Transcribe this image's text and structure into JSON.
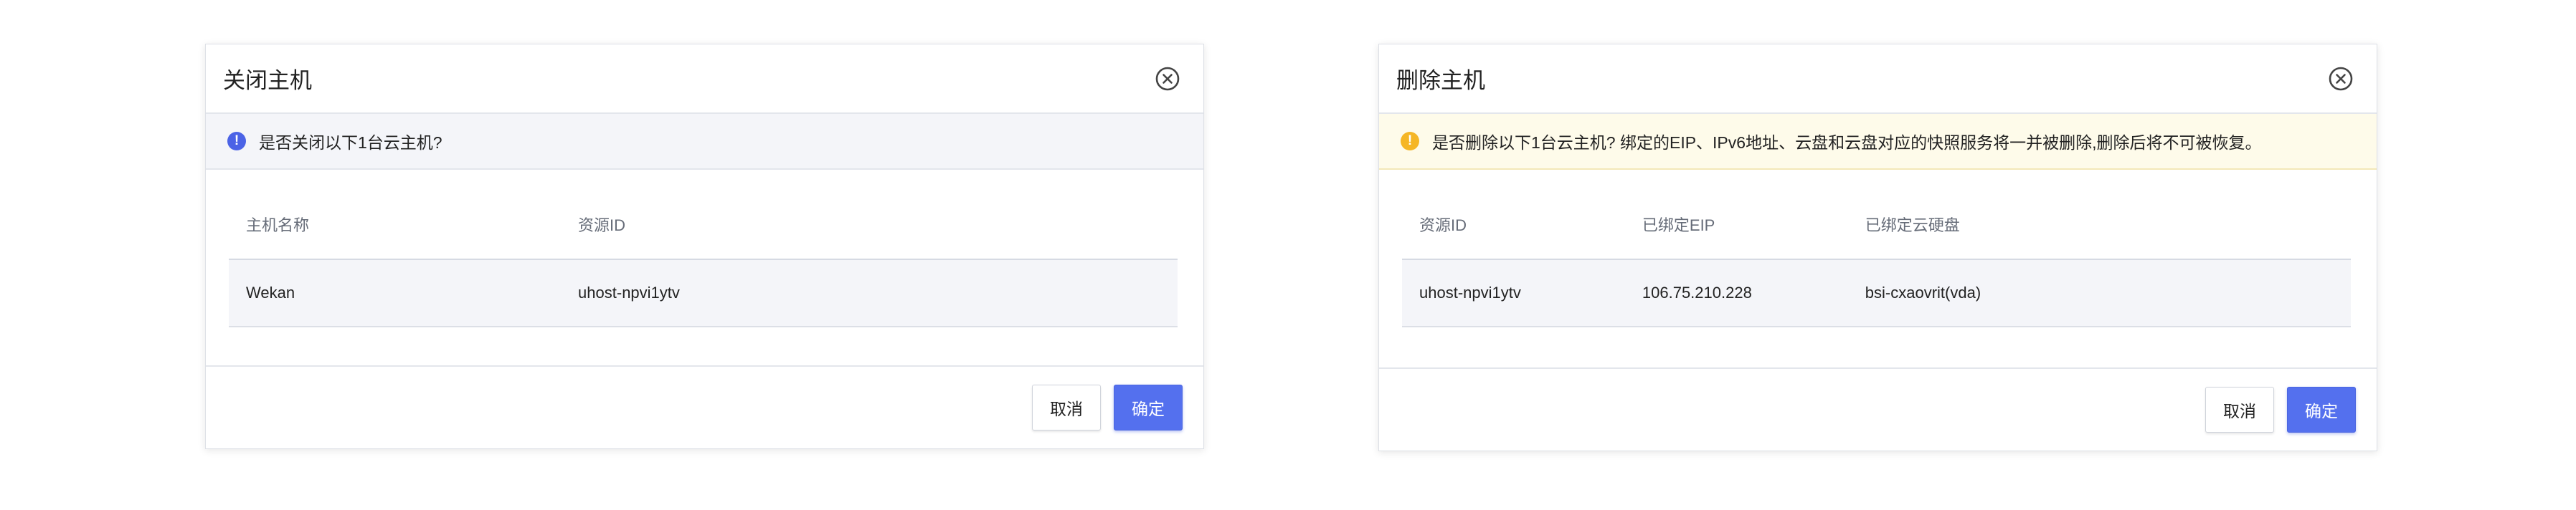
{
  "shutdown_dialog": {
    "title": "关闭主机",
    "message": "是否关闭以下1台云主机?",
    "table": {
      "headers": [
        "主机名称",
        "资源ID"
      ],
      "rows": [
        [
          "Wekan",
          "uhost-npvi1ytv"
        ]
      ]
    },
    "cancel_label": "取消",
    "confirm_label": "确定"
  },
  "delete_dialog": {
    "title": "删除主机",
    "message": "是否删除以下1台云主机?  绑定的EIP、IPv6地址、云盘和云盘对应的快照服务将一并被删除,删除后将不可被恢复。",
    "table": {
      "headers": [
        "资源ID",
        "已绑定EIP",
        "已绑定云硬盘"
      ],
      "rows": [
        [
          "uhost-npvi1ytv",
          "106.75.210.228",
          "bsi-cxaovrit(vda)"
        ]
      ]
    },
    "cancel_label": "取消",
    "confirm_label": "确定"
  },
  "icons": {
    "close": "close-circle-icon",
    "info": "exclamation-circle-icon",
    "warning": "warning-circle-icon"
  },
  "colors": {
    "primary": "#5470ee",
    "info_badge": "#4b63e6",
    "warning_badge": "#f5b626",
    "warning_banner": "#fefbea",
    "info_banner": "#f4f5f9"
  }
}
